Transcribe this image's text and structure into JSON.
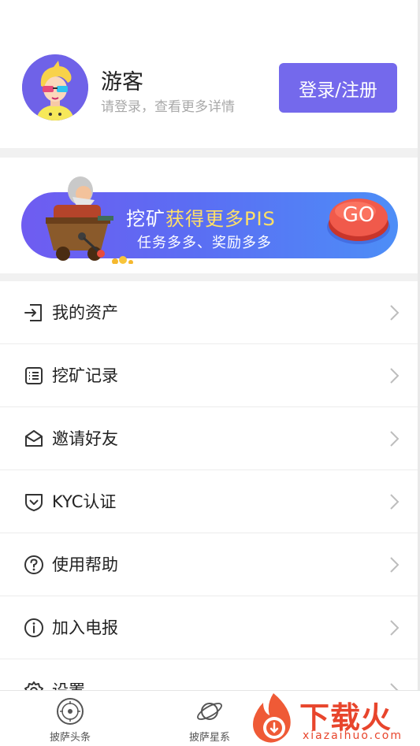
{
  "profile": {
    "username": "游客",
    "subtitle": "请登录，查看更多详情",
    "login_label": "登录/注册"
  },
  "banner": {
    "title_prefix": "挖矿",
    "title_highlight": "获得更多PIS",
    "subtitle": "任务多多、奖励多多",
    "go_label": "GO"
  },
  "menu": {
    "items": [
      {
        "label": "我的资产",
        "icon": "login-arrow-icon"
      },
      {
        "label": "挖矿记录",
        "icon": "list-icon"
      },
      {
        "label": "邀请好友",
        "icon": "envelope-icon"
      },
      {
        "label": "KYC认证",
        "icon": "shield-icon"
      },
      {
        "label": "使用帮助",
        "icon": "help-circle-icon"
      },
      {
        "label": "加入电报",
        "icon": "info-circle-icon"
      },
      {
        "label": "设置",
        "icon": "gear-icon"
      }
    ]
  },
  "tabbar": {
    "tabs": [
      {
        "label": "披萨头条",
        "icon": "news-icon"
      },
      {
        "label": "披萨星系",
        "icon": "planet-icon"
      }
    ]
  },
  "watermark": {
    "brand": "下载火",
    "domain": "xiazaihuo.com"
  },
  "colors": {
    "accent": "#7469ec",
    "banner_start": "#6f5cf1",
    "banner_end": "#4d8ef7",
    "go_button": "#f05a4b",
    "watermark": "#e8452c"
  }
}
